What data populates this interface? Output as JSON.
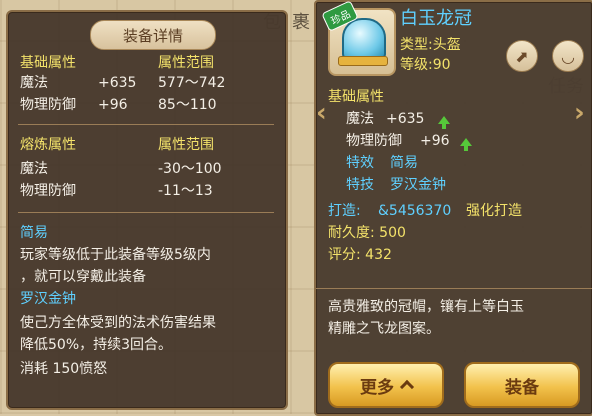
{
  "background": {
    "glyph1": "包",
    "glyph2": "裹",
    "glyph3": "任务"
  },
  "left": {
    "title": "装备详情",
    "basic": {
      "header": "基础属性",
      "range_header": "属性范围",
      "rows": [
        {
          "name": "魔法",
          "value": "+635",
          "range": "577～742"
        },
        {
          "name": "物理防御",
          "value": "+96",
          "range": "85～110"
        }
      ]
    },
    "smelt": {
      "header": "熔炼属性",
      "range_header": "属性范围",
      "rows": [
        {
          "name": "魔法",
          "range": "-30～100"
        },
        {
          "name": "物理防御",
          "range": "-11～13"
        }
      ]
    },
    "effect_title": "简易",
    "effect_desc_1": "玩家等级低于此装备等级5级内",
    "effect_desc_2": "，就可以穿戴此装备",
    "skill_title": "罗汉金钟",
    "skill_desc_1": "使己方全体受到的法术伤害结果",
    "skill_desc_2": "降低50%，持续3回合。",
    "skill_cost": "消耗 150愤怒"
  },
  "right": {
    "badge": "珍品",
    "name": "白玉龙冠",
    "type": "类型:头盔",
    "level": "等级:90",
    "basic_header": "基础属性",
    "attr1_name": "魔法",
    "attr1_value": "+635",
    "attr2_name": "物理防御",
    "attr2_value": "+96",
    "effect_label": "特效",
    "effect_value": "简易",
    "skill_label": "特技",
    "skill_value": "罗汉金钟",
    "forge_label": "打造:",
    "forge_value": "&5456370",
    "forge_action": "强化打造",
    "durability": "耐久度: 500",
    "score": "评分: 432",
    "desc_1": "高贵雅致的冠帽，镶有上等白玉",
    "desc_2": "精雕之飞龙图案。",
    "more_button": "更多",
    "equip_button": "装备",
    "arrow_left": "‹",
    "arrow_right": "›"
  }
}
